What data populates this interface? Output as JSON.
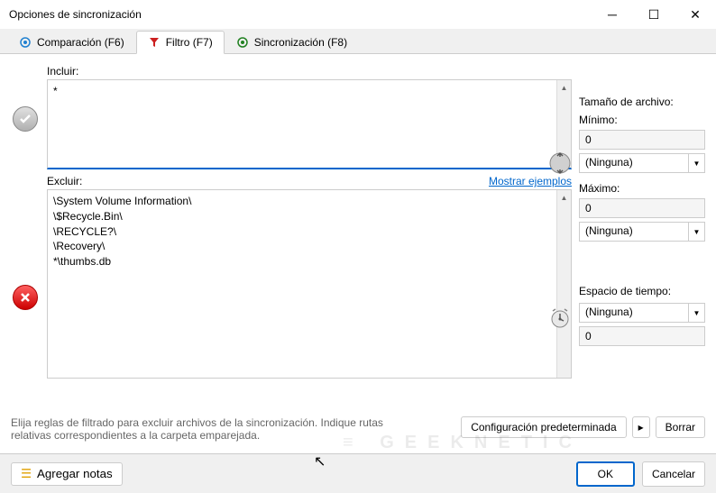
{
  "titlebar": {
    "title": "Opciones de sincronización"
  },
  "tabs": {
    "compare": "Comparación (F6)",
    "filter": "Filtro (F7)",
    "sync": "Sincronización (F8)"
  },
  "filters": {
    "include_label": "Incluir:",
    "include_value": "*",
    "exclude_label": "Excluir:",
    "exclude_value": "\\System Volume Information\\\n\\$Recycle.Bin\\\n\\RECYCLE?\\\n\\Recovery\\\n*\\thumbs.db",
    "examples_link": "Mostrar ejemplos"
  },
  "filesize": {
    "heading": "Tamaño de archivo:",
    "min_label": "Mínimo:",
    "min_value": "0",
    "min_unit": "(Ninguna)",
    "max_label": "Máximo:",
    "max_value": "0",
    "max_unit": "(Ninguna)"
  },
  "timespan": {
    "heading": "Espacio de tiempo:",
    "unit": "(Ninguna)",
    "value": "0"
  },
  "footer": {
    "help_text": "Elija reglas de filtrado para excluir archivos de la sincronización. Indique rutas relativas correspondientes a la carpeta emparejada.",
    "default_config": "Configuración predeterminada",
    "clear": "Borrar"
  },
  "bottom": {
    "add_notes": "Agregar notas",
    "ok": "OK",
    "cancel": "Cancelar"
  }
}
